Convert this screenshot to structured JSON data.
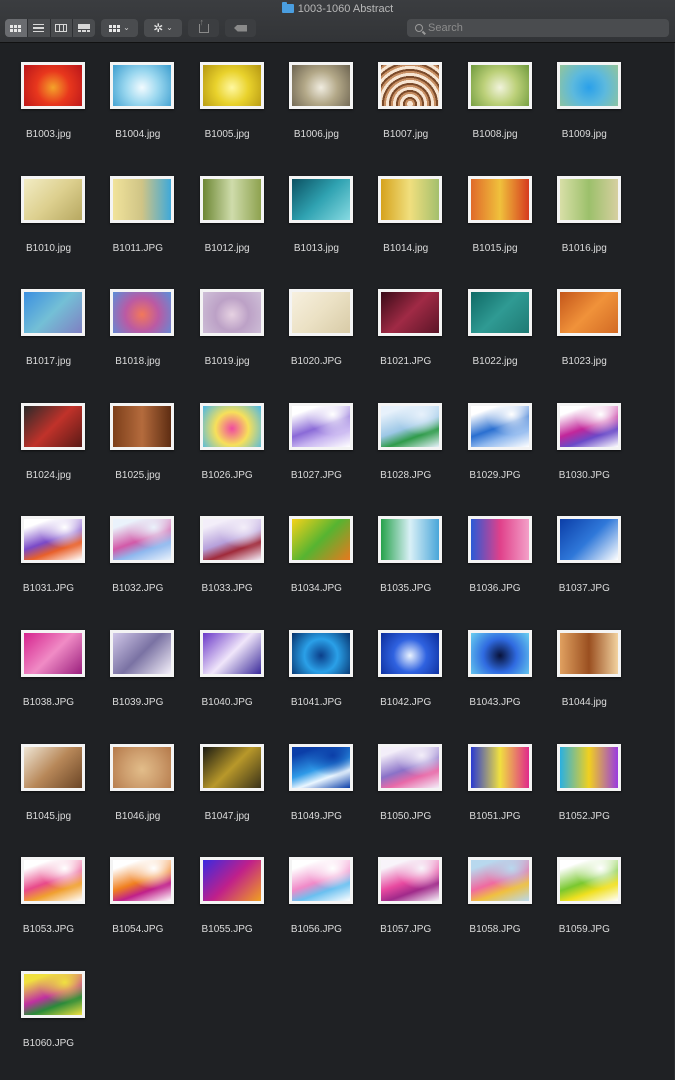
{
  "window": {
    "title": "1003-1060 Abstract"
  },
  "toolbar": {
    "view_modes": [
      "icon-view-icon",
      "list-view-icon",
      "column-view-icon",
      "gallery-view-icon"
    ],
    "active_view": 0,
    "group_icon": "group-grid-icon",
    "action_icon": "gear-icon",
    "share_icon": "share-icon",
    "tag_icon": "tag-icon"
  },
  "search": {
    "placeholder": "Search",
    "value": ""
  },
  "files": [
    {
      "name": "B1003.jpg",
      "colors": [
        "#f4a32a",
        "#e8371d",
        "#b8151a"
      ],
      "style": "radial"
    },
    {
      "name": "B1004.jpg",
      "colors": [
        "#f2fbff",
        "#9ad7ef",
        "#3b9dcf"
      ],
      "style": "radial"
    },
    {
      "name": "B1005.jpg",
      "colors": [
        "#fff8a0",
        "#e9d22c",
        "#b49612"
      ],
      "style": "radial"
    },
    {
      "name": "B1006.jpg",
      "colors": [
        "#f0ece0",
        "#b3a888",
        "#6c6350"
      ],
      "style": "radial"
    },
    {
      "name": "B1007.jpg",
      "colors": [
        "#f7e5d2",
        "#c58d61",
        "#7a4a2a"
      ],
      "style": "rings"
    },
    {
      "name": "B1008.jpg",
      "colors": [
        "#f1f3dc",
        "#bcd079",
        "#6f9a3c"
      ],
      "style": "radial"
    },
    {
      "name": "B1009.jpg",
      "colors": [
        "#2aa0ea",
        "#5cb9de",
        "#93c59a"
      ],
      "style": "radial"
    },
    {
      "name": "B1010.jpg",
      "colors": [
        "#f2ecc4",
        "#ddd08f",
        "#b7a861"
      ],
      "style": "diag"
    },
    {
      "name": "B1011.JPG",
      "colors": [
        "#f1e39b",
        "#cfc486",
        "#3fa9d9"
      ],
      "style": "linear"
    },
    {
      "name": "B1012.jpg",
      "colors": [
        "#6d8734",
        "#cfdcab",
        "#8ea24f"
      ],
      "style": "linear"
    },
    {
      "name": "B1013.jpg",
      "colors": [
        "#0b5162",
        "#2fa2b1",
        "#87dae2"
      ],
      "style": "diag"
    },
    {
      "name": "B1014.jpg",
      "colors": [
        "#d6a31d",
        "#f0df7e",
        "#a4bf6d"
      ],
      "style": "linear"
    },
    {
      "name": "B1015.jpg",
      "colors": [
        "#e06a2a",
        "#f0c13c",
        "#d63b1e"
      ],
      "style": "linear"
    },
    {
      "name": "B1016.jpg",
      "colors": [
        "#d8dfa7",
        "#9cc06b",
        "#d6cfa0"
      ],
      "style": "linear"
    },
    {
      "name": "B1017.jpg",
      "colors": [
        "#3b8fe0",
        "#74bfd6",
        "#7f7fc2"
      ],
      "style": "diag"
    },
    {
      "name": "B1018.jpg",
      "colors": [
        "#f2785a",
        "#bb5aa3",
        "#5b8fd9"
      ],
      "style": "radial"
    },
    {
      "name": "B1019.jpg",
      "colors": [
        "#e6d2e2",
        "#bca1c6",
        "#cfc0d8"
      ],
      "style": "radial"
    },
    {
      "name": "B1020.JPG",
      "colors": [
        "#f7f0df",
        "#ebe1c4",
        "#d8cba7"
      ],
      "style": "diag"
    },
    {
      "name": "B1021.JPG",
      "colors": [
        "#3a0b17",
        "#a02a45",
        "#5b1527"
      ],
      "style": "diag"
    },
    {
      "name": "B1022.jpg",
      "colors": [
        "#0f6a66",
        "#2f9a93",
        "#1f7a74"
      ],
      "style": "diag"
    },
    {
      "name": "B1023.jpg",
      "colors": [
        "#c4561a",
        "#f0923a",
        "#d26a24"
      ],
      "style": "diag"
    },
    {
      "name": "B1024.jpg",
      "colors": [
        "#2a2a2a",
        "#c0322a",
        "#5a1a16"
      ],
      "style": "diag"
    },
    {
      "name": "B1025.jpg",
      "colors": [
        "#7d3f1a",
        "#b46b3d",
        "#5e2d12"
      ],
      "style": "linear"
    },
    {
      "name": "B1026.JPG",
      "colors": [
        "#f04aa0",
        "#f7e05a",
        "#4ab7e7"
      ],
      "style": "radial"
    },
    {
      "name": "B1027.JPG",
      "colors": [
        "#ffffff",
        "#8a6ad7",
        "#c7b4f0"
      ],
      "style": "swirl"
    },
    {
      "name": "B1028.JPG",
      "colors": [
        "#e7f1fb",
        "#9cc7e6",
        "#2f9b4a"
      ],
      "style": "swirl"
    },
    {
      "name": "B1029.JPG",
      "colors": [
        "#ffffff",
        "#2a6fd0",
        "#8fb8ee"
      ],
      "style": "swirl"
    },
    {
      "name": "B1030.JPG",
      "colors": [
        "#ffffff",
        "#c2279a",
        "#6a4ac8"
      ],
      "style": "swirl"
    },
    {
      "name": "B1031.JPG",
      "colors": [
        "#ffffff",
        "#7a4ac8",
        "#e8602a"
      ],
      "style": "swirl"
    },
    {
      "name": "B1032.JPG",
      "colors": [
        "#eaf2fb",
        "#d25aa8",
        "#8fb8ee"
      ],
      "style": "swirl"
    },
    {
      "name": "B1033.JPG",
      "colors": [
        "#f3eef9",
        "#b6a0db",
        "#a02a3a"
      ],
      "style": "swirl"
    },
    {
      "name": "B1034.JPG",
      "colors": [
        "#f5d21a",
        "#56b431",
        "#e8781e"
      ],
      "style": "diag"
    },
    {
      "name": "B1035.JPG",
      "colors": [
        "#27a24c",
        "#d9f0f7",
        "#4aa6d9"
      ],
      "style": "linear"
    },
    {
      "name": "B1036.JPG",
      "colors": [
        "#2a5ad6",
        "#e0408a",
        "#f3a0c8"
      ],
      "style": "linear"
    },
    {
      "name": "B1037.JPG",
      "colors": [
        "#0b3ea8",
        "#2f78d9",
        "#ffffff"
      ],
      "style": "diag"
    },
    {
      "name": "B1038.JPG",
      "colors": [
        "#d5238e",
        "#f08bc5",
        "#9a1f7d"
      ],
      "style": "diag"
    },
    {
      "name": "B1039.JPG",
      "colors": [
        "#d0c7e8",
        "#7a72a3",
        "#f4f0fa"
      ],
      "style": "diag"
    },
    {
      "name": "B1040.JPG",
      "colors": [
        "#6a38c8",
        "#f0e6fa",
        "#3a2a9a"
      ],
      "style": "diag"
    },
    {
      "name": "B1041.JPG",
      "colors": [
        "#0b3f8a",
        "#2aa0e8",
        "#06306a"
      ],
      "style": "radial"
    },
    {
      "name": "B1042.JPG",
      "colors": [
        "#eaf3ff",
        "#2f62e0",
        "#0b2c9a"
      ],
      "style": "radial"
    },
    {
      "name": "B1043.JPG",
      "colors": [
        "#08123a",
        "#2f6ae0",
        "#6ad0f0"
      ],
      "style": "radial"
    },
    {
      "name": "B1044.jpg",
      "colors": [
        "#e0a060",
        "#9a4f20",
        "#f2d2a0"
      ],
      "style": "linear"
    },
    {
      "name": "B1045.jpg",
      "colors": [
        "#efe6d5",
        "#b78758",
        "#6b4526"
      ],
      "style": "diag"
    },
    {
      "name": "B1046.jpg",
      "colors": [
        "#e2bd8a",
        "#cfa070",
        "#b4794a"
      ],
      "style": "radial"
    },
    {
      "name": "B1047.jpg",
      "colors": [
        "#1a1a12",
        "#b8982a",
        "#3a3218"
      ],
      "style": "diag"
    },
    {
      "name": "B1049.JPG",
      "colors": [
        "#0b3ea8",
        "#2f9ae8",
        "#eaf6ff"
      ],
      "style": "swirl"
    },
    {
      "name": "B1050.JPG",
      "colors": [
        "#f3eef9",
        "#8a72c8",
        "#e86aa8"
      ],
      "style": "swirl"
    },
    {
      "name": "B1051.JPG",
      "colors": [
        "#2a3ad0",
        "#f0e040",
        "#e02a8a"
      ],
      "style": "linear"
    },
    {
      "name": "B1052.JPG",
      "colors": [
        "#2ab0e0",
        "#f0d020",
        "#9a3ae0"
      ],
      "style": "linear"
    },
    {
      "name": "B1053.JPG",
      "colors": [
        "#ffffff",
        "#e84a8a",
        "#f0a030"
      ],
      "style": "swirl"
    },
    {
      "name": "B1054.JPG",
      "colors": [
        "#ffffff",
        "#f08020",
        "#c0208a"
      ],
      "style": "swirl"
    },
    {
      "name": "B1055.JPG",
      "colors": [
        "#3a2ae0",
        "#c0208a",
        "#f0a020"
      ],
      "style": "diag"
    },
    {
      "name": "B1056.JPG",
      "colors": [
        "#ffffff",
        "#f08ac8",
        "#6ac0f0"
      ],
      "style": "swirl"
    },
    {
      "name": "B1057.JPG",
      "colors": [
        "#f8f4fa",
        "#e84aa0",
        "#a02a8a"
      ],
      "style": "swirl"
    },
    {
      "name": "B1058.JPG",
      "colors": [
        "#b8d8ee",
        "#f06aa0",
        "#f0c040"
      ],
      "style": "swirl"
    },
    {
      "name": "B1059.JPG",
      "colors": [
        "#ffffff",
        "#7ac830",
        "#f0e020"
      ],
      "style": "swirl"
    },
    {
      "name": "B1060.JPG",
      "colors": [
        "#f0e040",
        "#c030a0",
        "#2a8a3a"
      ],
      "style": "swirl"
    }
  ]
}
